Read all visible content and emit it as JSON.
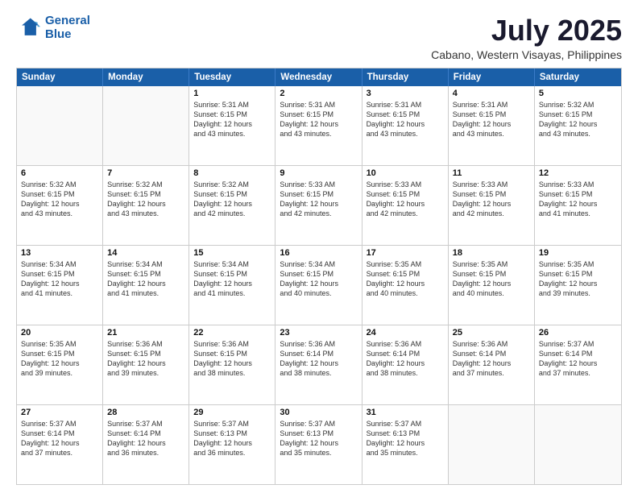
{
  "header": {
    "logo_line1": "General",
    "logo_line2": "Blue",
    "title": "July 2025",
    "subtitle": "Cabano, Western Visayas, Philippines"
  },
  "weekdays": [
    "Sunday",
    "Monday",
    "Tuesday",
    "Wednesday",
    "Thursday",
    "Friday",
    "Saturday"
  ],
  "weeks": [
    [
      {
        "day": "",
        "info": ""
      },
      {
        "day": "",
        "info": ""
      },
      {
        "day": "1",
        "info": "Sunrise: 5:31 AM\nSunset: 6:15 PM\nDaylight: 12 hours\nand 43 minutes."
      },
      {
        "day": "2",
        "info": "Sunrise: 5:31 AM\nSunset: 6:15 PM\nDaylight: 12 hours\nand 43 minutes."
      },
      {
        "day": "3",
        "info": "Sunrise: 5:31 AM\nSunset: 6:15 PM\nDaylight: 12 hours\nand 43 minutes."
      },
      {
        "day": "4",
        "info": "Sunrise: 5:31 AM\nSunset: 6:15 PM\nDaylight: 12 hours\nand 43 minutes."
      },
      {
        "day": "5",
        "info": "Sunrise: 5:32 AM\nSunset: 6:15 PM\nDaylight: 12 hours\nand 43 minutes."
      }
    ],
    [
      {
        "day": "6",
        "info": "Sunrise: 5:32 AM\nSunset: 6:15 PM\nDaylight: 12 hours\nand 43 minutes."
      },
      {
        "day": "7",
        "info": "Sunrise: 5:32 AM\nSunset: 6:15 PM\nDaylight: 12 hours\nand 43 minutes."
      },
      {
        "day": "8",
        "info": "Sunrise: 5:32 AM\nSunset: 6:15 PM\nDaylight: 12 hours\nand 42 minutes."
      },
      {
        "day": "9",
        "info": "Sunrise: 5:33 AM\nSunset: 6:15 PM\nDaylight: 12 hours\nand 42 minutes."
      },
      {
        "day": "10",
        "info": "Sunrise: 5:33 AM\nSunset: 6:15 PM\nDaylight: 12 hours\nand 42 minutes."
      },
      {
        "day": "11",
        "info": "Sunrise: 5:33 AM\nSunset: 6:15 PM\nDaylight: 12 hours\nand 42 minutes."
      },
      {
        "day": "12",
        "info": "Sunrise: 5:33 AM\nSunset: 6:15 PM\nDaylight: 12 hours\nand 41 minutes."
      }
    ],
    [
      {
        "day": "13",
        "info": "Sunrise: 5:34 AM\nSunset: 6:15 PM\nDaylight: 12 hours\nand 41 minutes."
      },
      {
        "day": "14",
        "info": "Sunrise: 5:34 AM\nSunset: 6:15 PM\nDaylight: 12 hours\nand 41 minutes."
      },
      {
        "day": "15",
        "info": "Sunrise: 5:34 AM\nSunset: 6:15 PM\nDaylight: 12 hours\nand 41 minutes."
      },
      {
        "day": "16",
        "info": "Sunrise: 5:34 AM\nSunset: 6:15 PM\nDaylight: 12 hours\nand 40 minutes."
      },
      {
        "day": "17",
        "info": "Sunrise: 5:35 AM\nSunset: 6:15 PM\nDaylight: 12 hours\nand 40 minutes."
      },
      {
        "day": "18",
        "info": "Sunrise: 5:35 AM\nSunset: 6:15 PM\nDaylight: 12 hours\nand 40 minutes."
      },
      {
        "day": "19",
        "info": "Sunrise: 5:35 AM\nSunset: 6:15 PM\nDaylight: 12 hours\nand 39 minutes."
      }
    ],
    [
      {
        "day": "20",
        "info": "Sunrise: 5:35 AM\nSunset: 6:15 PM\nDaylight: 12 hours\nand 39 minutes."
      },
      {
        "day": "21",
        "info": "Sunrise: 5:36 AM\nSunset: 6:15 PM\nDaylight: 12 hours\nand 39 minutes."
      },
      {
        "day": "22",
        "info": "Sunrise: 5:36 AM\nSunset: 6:15 PM\nDaylight: 12 hours\nand 38 minutes."
      },
      {
        "day": "23",
        "info": "Sunrise: 5:36 AM\nSunset: 6:14 PM\nDaylight: 12 hours\nand 38 minutes."
      },
      {
        "day": "24",
        "info": "Sunrise: 5:36 AM\nSunset: 6:14 PM\nDaylight: 12 hours\nand 38 minutes."
      },
      {
        "day": "25",
        "info": "Sunrise: 5:36 AM\nSunset: 6:14 PM\nDaylight: 12 hours\nand 37 minutes."
      },
      {
        "day": "26",
        "info": "Sunrise: 5:37 AM\nSunset: 6:14 PM\nDaylight: 12 hours\nand 37 minutes."
      }
    ],
    [
      {
        "day": "27",
        "info": "Sunrise: 5:37 AM\nSunset: 6:14 PM\nDaylight: 12 hours\nand 37 minutes."
      },
      {
        "day": "28",
        "info": "Sunrise: 5:37 AM\nSunset: 6:14 PM\nDaylight: 12 hours\nand 36 minutes."
      },
      {
        "day": "29",
        "info": "Sunrise: 5:37 AM\nSunset: 6:13 PM\nDaylight: 12 hours\nand 36 minutes."
      },
      {
        "day": "30",
        "info": "Sunrise: 5:37 AM\nSunset: 6:13 PM\nDaylight: 12 hours\nand 35 minutes."
      },
      {
        "day": "31",
        "info": "Sunrise: 5:37 AM\nSunset: 6:13 PM\nDaylight: 12 hours\nand 35 minutes."
      },
      {
        "day": "",
        "info": ""
      },
      {
        "day": "",
        "info": ""
      }
    ]
  ]
}
